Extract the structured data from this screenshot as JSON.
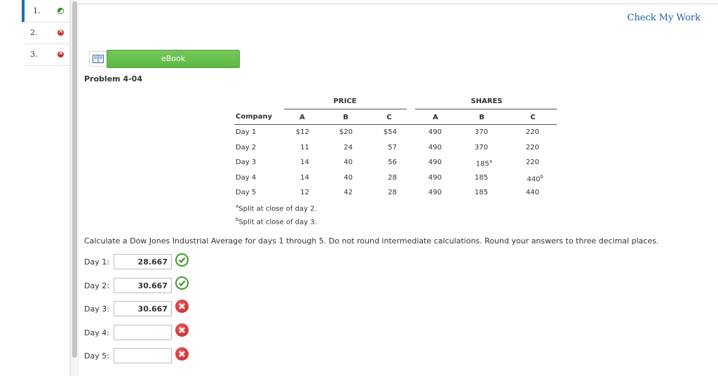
{
  "nav": {
    "questions": [
      {
        "label": "1.",
        "status": "partial"
      },
      {
        "label": "2.",
        "status": "wrong"
      },
      {
        "label": "3.",
        "status": "wrong"
      }
    ]
  },
  "header": {
    "check_my_work": "Check My Work"
  },
  "ebook": {
    "label": "eBook"
  },
  "problem": {
    "title": "Problem 4-04"
  },
  "table": {
    "group_price": "PRICE",
    "group_shares": "SHARES",
    "col_company": "Company",
    "price_cols": [
      "A",
      "B",
      "C"
    ],
    "share_cols": [
      "A",
      "B",
      "C"
    ],
    "rows": [
      {
        "company": "Day 1",
        "pa": "$12",
        "pb": "$20",
        "pc": "$54",
        "sa": "490",
        "sb": "370",
        "sc": "220"
      },
      {
        "company": "Day 2",
        "pa": "11",
        "pb": "24",
        "pc": "57",
        "sa": "490",
        "sb": "370",
        "sc": "220"
      },
      {
        "company": "Day 3",
        "pa": "14",
        "pb": "40",
        "pc": "56",
        "sa": "490",
        "sb": "185",
        "sb_sup": "a",
        "sc": "220"
      },
      {
        "company": "Day 4",
        "pa": "14",
        "pb": "40",
        "pc": "28",
        "sa": "490",
        "sb": "185",
        "sc": "440",
        "sc_sup": "b"
      },
      {
        "company": "Day 5",
        "pa": "12",
        "pb": "42",
        "pc": "28",
        "sa": "490",
        "sb": "185",
        "sc": "440"
      }
    ],
    "footnote_a_sup": "a",
    "footnote_a": "Split at close of day 2.",
    "footnote_b_sup": "b",
    "footnote_b": "Split at close of day 3."
  },
  "instructions": "Calculate a Dow Jones Industrial Average for days 1 through 5. Do not round intermediate calculations. Round your answers to three decimal places.",
  "answers": [
    {
      "label": "Day 1:",
      "value": "28.667",
      "status": "correct"
    },
    {
      "label": "Day 2:",
      "value": "30.667",
      "status": "correct"
    },
    {
      "label": "Day 3:",
      "value": "30.667",
      "status": "incorrect"
    },
    {
      "label": "Day 4:",
      "value": "",
      "status": "incorrect"
    },
    {
      "label": "Day 5:",
      "value": "",
      "status": "incorrect"
    }
  ],
  "colors": {
    "accent_link": "#1f5fa6",
    "ebook_green": "#5db743",
    "correct": "#3f9b2a",
    "incorrect": "#c42525"
  }
}
